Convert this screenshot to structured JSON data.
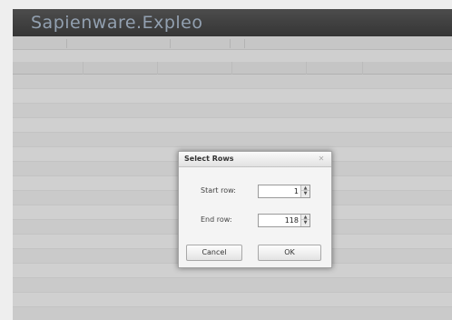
{
  "app": {
    "title": "Sapienware.Expleo"
  },
  "toolbar": {
    "items": [
      "",
      "",
      "",
      ""
    ]
  },
  "grid": {
    "headers": [
      "",
      "",
      "",
      "",
      ""
    ],
    "rows": [
      [
        "",
        "",
        "",
        "",
        ""
      ],
      [
        "",
        "",
        "",
        "",
        ""
      ],
      [
        "",
        "",
        "",
        "",
        ""
      ],
      [
        "",
        "",
        "",
        "",
        ""
      ],
      [
        "",
        "",
        "",
        "",
        ""
      ],
      [
        "",
        "",
        "",
        "",
        ""
      ],
      [
        "",
        "",
        "",
        "",
        ""
      ],
      [
        "",
        "",
        "",
        "",
        ""
      ],
      [
        "",
        "",
        "",
        "",
        ""
      ],
      [
        "",
        "",
        "",
        "",
        ""
      ],
      [
        "",
        "",
        "",
        "",
        ""
      ],
      [
        "",
        "",
        "",
        "",
        ""
      ],
      [
        "",
        "",
        "",
        "",
        ""
      ],
      [
        "",
        "",
        "",
        "",
        ""
      ],
      [
        "",
        "",
        "",
        "",
        ""
      ],
      [
        "",
        "",
        "",
        "",
        ""
      ],
      [
        "",
        "",
        "",
        "",
        ""
      ]
    ]
  },
  "dialog": {
    "title": "Select Rows",
    "close_glyph": "✕",
    "start_label": "Start row:",
    "start_value": "1",
    "end_label": "End row:",
    "end_value": "118",
    "cancel_label": "Cancel",
    "ok_label": "OK"
  },
  "glyphs": {
    "spin_up": "▲",
    "spin_down": "▼"
  }
}
